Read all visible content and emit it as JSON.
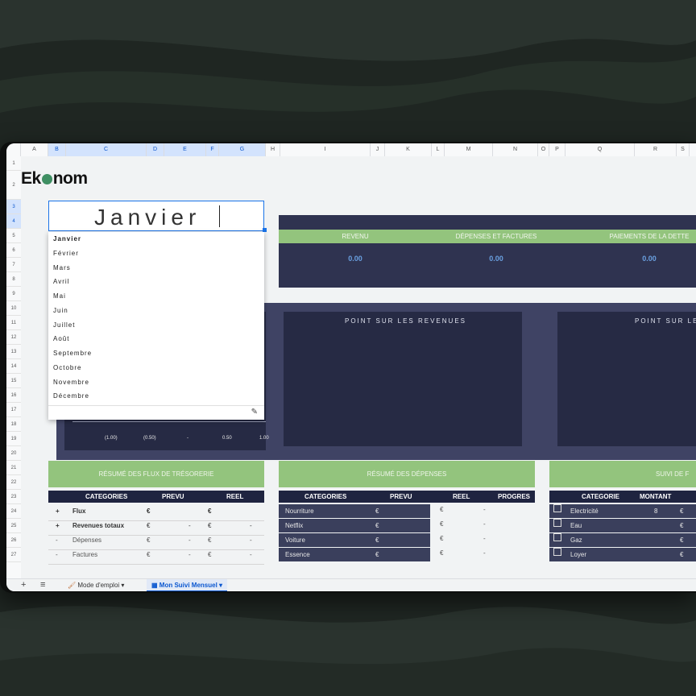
{
  "brand": {
    "logo_prefix": "Ek",
    "logo_suffix": "nom"
  },
  "columns": [
    "A",
    "B",
    "C",
    "D",
    "E",
    "F",
    "G",
    "H",
    "I",
    "J",
    "K",
    "L",
    "M",
    "N",
    "O",
    "P",
    "Q",
    "R",
    "S"
  ],
  "rows": [
    "1",
    "2",
    "3",
    "4",
    "5",
    "6",
    "7",
    "8",
    "9",
    "10",
    "11",
    "12",
    "13",
    "14",
    "15",
    "16",
    "17",
    "18",
    "19",
    "20",
    "21",
    "22",
    "23",
    "24",
    "25",
    "26",
    "27"
  ],
  "month_cell": {
    "value": "Janvier"
  },
  "month_dropdown": {
    "options": [
      "Janvier",
      "Février",
      "Mars",
      "Avril",
      "Mai",
      "Juin",
      "Juillet",
      "Août",
      "Septembre",
      "Octobre",
      "Novembre",
      "Décembre"
    ]
  },
  "summary": {
    "headers": [
      "REVENU",
      "DÉPENSES ET FACTURES",
      "PAIEMENTS DE LA DETTE"
    ],
    "values": [
      "0.00",
      "0.00",
      "0.00"
    ]
  },
  "chart_panels": {
    "left_title": "POINT SUR LES REVENUES",
    "right_title": "POINT SUR LE"
  },
  "chart_axis": [
    "(1.00)",
    "(0.50)",
    "-",
    "0.50",
    "1.00"
  ],
  "cashflow": {
    "title": "RÉSUMÉ DES FLUX DE TRÉSORERIE",
    "headers": [
      "CATEGORIES",
      "PREVU",
      "REEL"
    ],
    "rows": [
      {
        "sign": "+",
        "label": "Flux",
        "prevu_cur": "€",
        "prevu_val": "",
        "reel_cur": "€",
        "reel_val": ""
      },
      {
        "sign": "+",
        "label": "Revenues totaux",
        "prevu_cur": "€",
        "prevu_val": "-",
        "reel_cur": "€",
        "reel_val": "-"
      },
      {
        "sign": "-",
        "label": "Dépenses",
        "prevu_cur": "€",
        "prevu_val": "-",
        "reel_cur": "€",
        "reel_val": "-"
      },
      {
        "sign": "-",
        "label": "Factures",
        "prevu_cur": "€",
        "prevu_val": "-",
        "reel_cur": "€",
        "reel_val": "-"
      }
    ]
  },
  "expenses": {
    "title": "RÉSUMÉ DES DÉPENSES",
    "headers": [
      "CATEGORIES",
      "PREVU",
      "REEL",
      "PROGRES"
    ],
    "rows": [
      {
        "label": "Nourriture",
        "prevu_cur": "€",
        "reel_cur": "€",
        "reel_val": "-"
      },
      {
        "label": "Netflix",
        "prevu_cur": "€",
        "reel_cur": "€",
        "reel_val": "-"
      },
      {
        "label": "Voiture",
        "prevu_cur": "€",
        "reel_cur": "€",
        "reel_val": "-"
      },
      {
        "label": "Essence",
        "prevu_cur": "€",
        "reel_cur": "€",
        "reel_val": "-"
      }
    ]
  },
  "bills": {
    "title": "SUIVI DE F",
    "headers": [
      "CATEGORIE",
      "MONTANT"
    ],
    "rows": [
      {
        "label": "Electricité",
        "amount": "8",
        "cur": "€"
      },
      {
        "label": "Eau",
        "amount": "",
        "cur": "€"
      },
      {
        "label": "Gaz",
        "amount": "",
        "cur": "€"
      },
      {
        "label": "Loyer",
        "amount": "",
        "cur": "€"
      }
    ]
  },
  "tabs": {
    "add": "+",
    "menu": "≡",
    "tab1": "Mode d'emploi",
    "tab2": "Mon Suivi Mensuel",
    "arrow": "▾"
  },
  "colors": {
    "green_band": "#93c47d",
    "navy": "#2f3350",
    "accent_blue": "#1a73e8"
  }
}
